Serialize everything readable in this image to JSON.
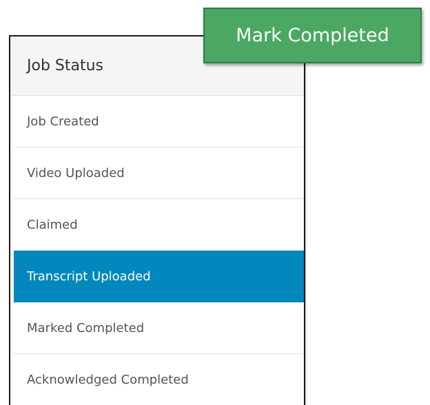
{
  "panel": {
    "title": "Job Status",
    "items": [
      {
        "label": "Job Created",
        "active": false
      },
      {
        "label": "Video Uploaded",
        "active": false
      },
      {
        "label": "Claimed",
        "active": false
      },
      {
        "label": "Transcript Uploaded",
        "active": true
      },
      {
        "label": "Marked Completed",
        "active": false
      },
      {
        "label": "Acknowledged Completed",
        "active": false
      }
    ]
  },
  "action": {
    "label": "Mark Completed"
  },
  "colors": {
    "active_item": "#0288bd",
    "button": "#4aa863",
    "button_border": "#2f7d46"
  }
}
